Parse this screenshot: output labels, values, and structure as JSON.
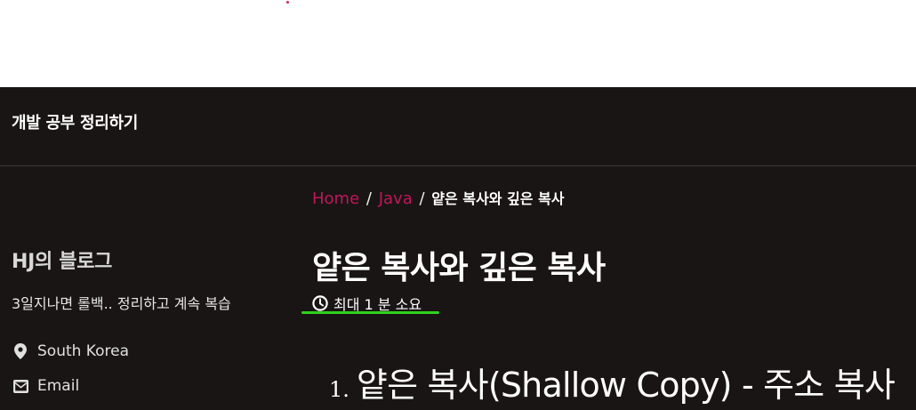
{
  "masthead": {
    "site_title": "개발 공부 정리하기"
  },
  "breadcrumb": {
    "items": [
      "Home",
      "Java"
    ],
    "separator": "/",
    "current": "얕은 복사와 깊은 복사"
  },
  "sidebar": {
    "author_name": "HJ의 블로그",
    "author_bio": "3일지나면 롤백.. 정리하고 계속 복습",
    "location": "South Korea",
    "email_label": "Email"
  },
  "post": {
    "title": "얕은 복사와 깊은 복사",
    "read_time": "최대 1 분 소요",
    "section_number": "1.",
    "section_heading": "얕은 복사(Shallow Copy) - 주소 복사"
  },
  "colors": {
    "background_dark": "#1a1515",
    "link_accent": "#c0175a",
    "annotation_underline": "#2fd21e"
  },
  "icons": {
    "read_time": "clock-icon",
    "location": "map-marker-icon",
    "email": "envelope-icon"
  }
}
